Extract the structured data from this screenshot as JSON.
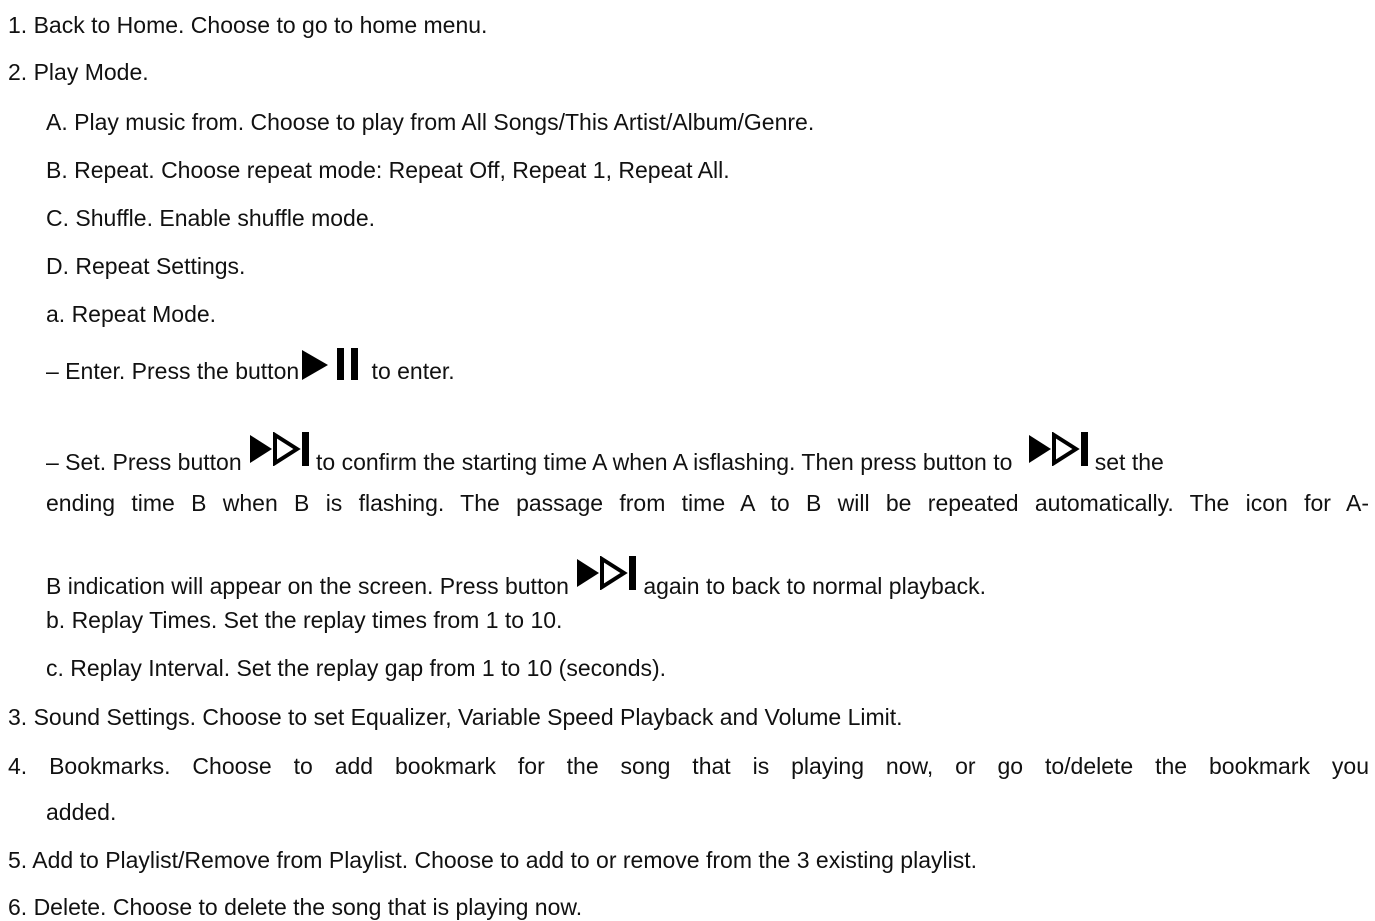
{
  "items": {
    "i1": "1. Back to Home. Choose to go to home menu.",
    "i2": "2. Play Mode.",
    "i2a": "A. Play music from. Choose to play from All Songs/This Artist/Album/Genre.",
    "i2b": "B. Repeat. Choose repeat mode: Repeat Off, Repeat 1, Repeat All.",
    "i2c": "C. Shuffle. Enable shuffle mode.",
    "i2d": "D. Repeat Settings.",
    "i2d_a": "a. Repeat Mode.",
    "enter_pre": "– Enter. Press the button",
    "enter_post": " to enter.",
    "set_pre": "– Set. Press button ",
    "set_mid": "to confirm the starting time A when A isflashing. Then press button to ",
    "set_post": "set the",
    "set_line2": "ending time B when B is flashing. The passage from time A to B will be repeated automatically. The icon for A-",
    "set_line3_pre": "B indication will appear on the screen. Press button ",
    "set_line3_post": "again to back to normal playback.",
    "i2d_b": "b. Replay Times. Set the replay times from 1 to 10.",
    "i2d_c": "c. Replay Interval. Set the replay gap from 1 to 10 (seconds).",
    "i3": "3.  Sound Settings. Choose to set Equalizer, Variable Speed Playback and Volume Limit.",
    "i4_line1": "4. Bookmarks. Choose to add bookmark for the song that is playing now, or go to/delete the bookmark you",
    "i4_line2": "added.",
    "i5": "5. Add to Playlist/Remove from Playlist. Choose to add to or remove from the 3 existing playlist.",
    "i6": "6. Delete. Choose to delete the song that is playing now."
  },
  "icons": {
    "play_pause": "play-pause-icon",
    "next": "next-track-icon"
  }
}
